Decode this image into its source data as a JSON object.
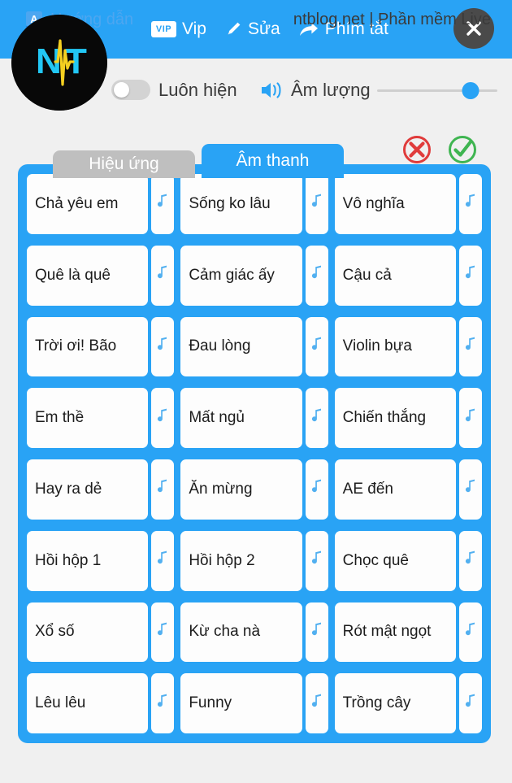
{
  "window": {
    "accent_color": "#29a3f5",
    "background_color": "#f0f0f0"
  },
  "header": {
    "logo_alt": "NT logo",
    "vip_badge": "VIP",
    "vip_label": "Vip",
    "edit_label": "Sửa",
    "shortcut_label": "Phím tắt",
    "close_label": "✕"
  },
  "controls": {
    "always_show_label": "Luôn hiện",
    "always_show_state": "off",
    "volume_label": "Âm lượng",
    "volume_percent": 78
  },
  "tabs": [
    {
      "label": "Hiệu ứng",
      "active": false
    },
    {
      "label": "Âm thanh",
      "active": true
    }
  ],
  "tab_tools": {
    "cancel_color": "#e03b3b",
    "confirm_color": "#3fb551"
  },
  "sounds": [
    {
      "label": "Chả yêu em"
    },
    {
      "label": "Sống ko lâu"
    },
    {
      "label": "Vô nghĩa"
    },
    {
      "label": "Quê là quê"
    },
    {
      "label": "Cảm giác ấy"
    },
    {
      "label": "Cậu cả"
    },
    {
      "label": "Trời ơi! Bão"
    },
    {
      "label": "Đau lòng"
    },
    {
      "label": "Violin bựa"
    },
    {
      "label": "Em thề"
    },
    {
      "label": "Mất ngủ"
    },
    {
      "label": "Chiến thắng"
    },
    {
      "label": "Hay ra dẻ"
    },
    {
      "label": "Ăn mừng"
    },
    {
      "label": "AE đến"
    },
    {
      "label": "Hồi hộp 1"
    },
    {
      "label": "Hồi hộp 2"
    },
    {
      "label": "Chọc quê"
    },
    {
      "label": "Xổ số"
    },
    {
      "label": "Kừ cha nà"
    },
    {
      "label": "Rót mật ngọt"
    },
    {
      "label": "Lêu lêu"
    },
    {
      "label": "Funny"
    },
    {
      "label": "Trồng cây"
    }
  ],
  "footer": {
    "guide_badge": "A",
    "guide_label": "Hướng dẫn",
    "brand": "ntblog.net | Phần mềm Live"
  }
}
